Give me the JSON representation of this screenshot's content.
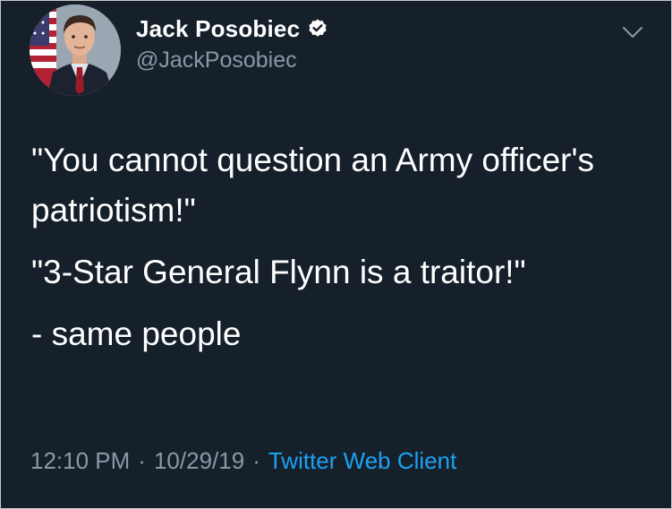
{
  "author": {
    "display_name": "Jack Posobiec",
    "handle": "@JackPosobiec",
    "verified": true
  },
  "tweet": {
    "paragraphs": [
      "\"You cannot question an Army officer's patriotism!\"",
      "\"3-Star General Flynn is a traitor!\"",
      "- same people"
    ]
  },
  "meta": {
    "time": "12:10 PM",
    "separator": "·",
    "date": "10/29/19",
    "client": "Twitter Web Client"
  },
  "icons": {
    "verified": "verified-badge-icon",
    "menu": "chevron-down-icon"
  },
  "colors": {
    "background": "#15202b",
    "text": "#ffffff",
    "secondary": "#8899a6",
    "link": "#1da1f2"
  }
}
